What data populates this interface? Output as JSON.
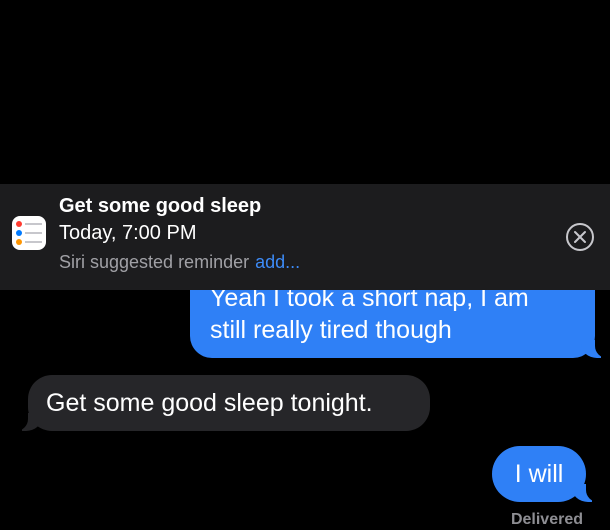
{
  "reminder_banner": {
    "title": "Get some good sleep",
    "time": "Today, 7:00 PM",
    "suggestion": "Siri suggested reminder",
    "add_label": "add...",
    "app_icon": "reminders-icon",
    "close_icon": "close-circle-icon",
    "accent_color": "#3d8bf7"
  },
  "messages": [
    {
      "direction": "sent",
      "lines": [
        "Yeah I took a short nap, I am",
        "still really tired though"
      ]
    },
    {
      "direction": "received",
      "text": "Get some good sleep tonight."
    },
    {
      "direction": "sent",
      "text": "I will"
    }
  ],
  "delivery_status": "Delivered",
  "colors": {
    "sent_bubble": "#2f80f6",
    "received_bubble": "#262629",
    "background": "#000000",
    "banner_background": "#1c1c1e"
  }
}
